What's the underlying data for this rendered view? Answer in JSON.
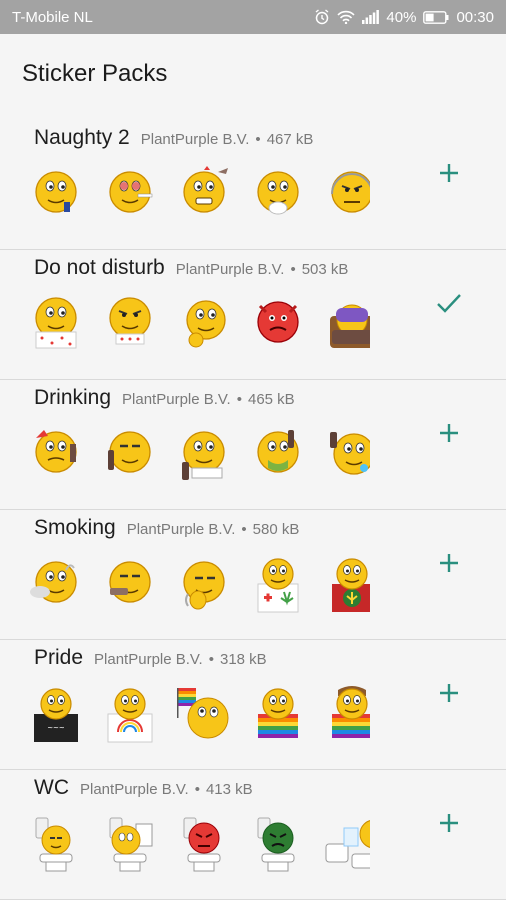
{
  "status_bar": {
    "carrier": "T-Mobile  NL",
    "battery": "40%",
    "time": "00:30"
  },
  "page_title": "Sticker Packs",
  "colors": {
    "accent": "#2a8f7f",
    "emoji_yellow": "#f7c518",
    "status_bar": "#a3a3a3"
  },
  "packs": [
    {
      "name": "Naughty 2",
      "publisher": "PlantPurple B.V.",
      "separator": "•",
      "size": "467 kB",
      "action_icon": "plus-icon"
    },
    {
      "name": "Do not disturb",
      "publisher": "PlantPurple B.V.",
      "separator": "•",
      "size": "503 kB",
      "action_icon": "check-icon"
    },
    {
      "name": "Drinking",
      "publisher": "PlantPurple B.V.",
      "separator": "•",
      "size": "465 kB",
      "action_icon": "plus-icon"
    },
    {
      "name": "Smoking",
      "publisher": "PlantPurple B.V.",
      "separator": "•",
      "size": "580 kB",
      "action_icon": "plus-icon"
    },
    {
      "name": "Pride",
      "publisher": "PlantPurple B.V.",
      "separator": "•",
      "size": "318 kB",
      "action_icon": "plus-icon"
    },
    {
      "name": "WC",
      "publisher": "PlantPurple B.V.",
      "separator": "•",
      "size": "413 kB",
      "action_icon": "plus-icon"
    }
  ]
}
